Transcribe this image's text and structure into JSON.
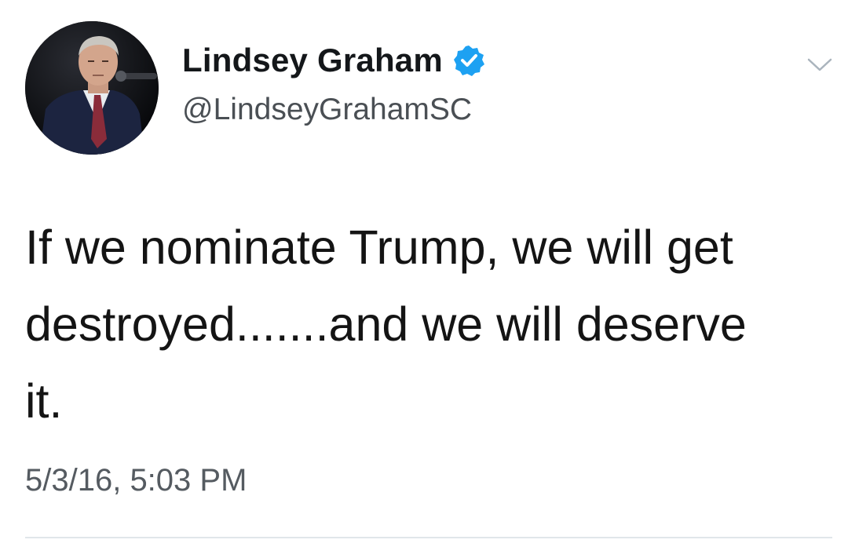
{
  "tweet": {
    "author": {
      "display_name": "Lindsey Graham",
      "handle": "@LindseyGrahamSC",
      "verified": true,
      "avatar_icon": "profile-photo",
      "verified_icon": "verified-badge-icon"
    },
    "text_lines": [
      "If we nominate Trump, we will get",
      "destroyed.......and we will deserve",
      "it."
    ],
    "timestamp": "5/3/16, 5:03 PM",
    "menu_icon": "chevron-down-icon"
  },
  "colors": {
    "verified_blue": "#1da1f2",
    "name_text": "#14171a",
    "secondary_text": "#555b61",
    "divider": "#e1e6ea"
  }
}
